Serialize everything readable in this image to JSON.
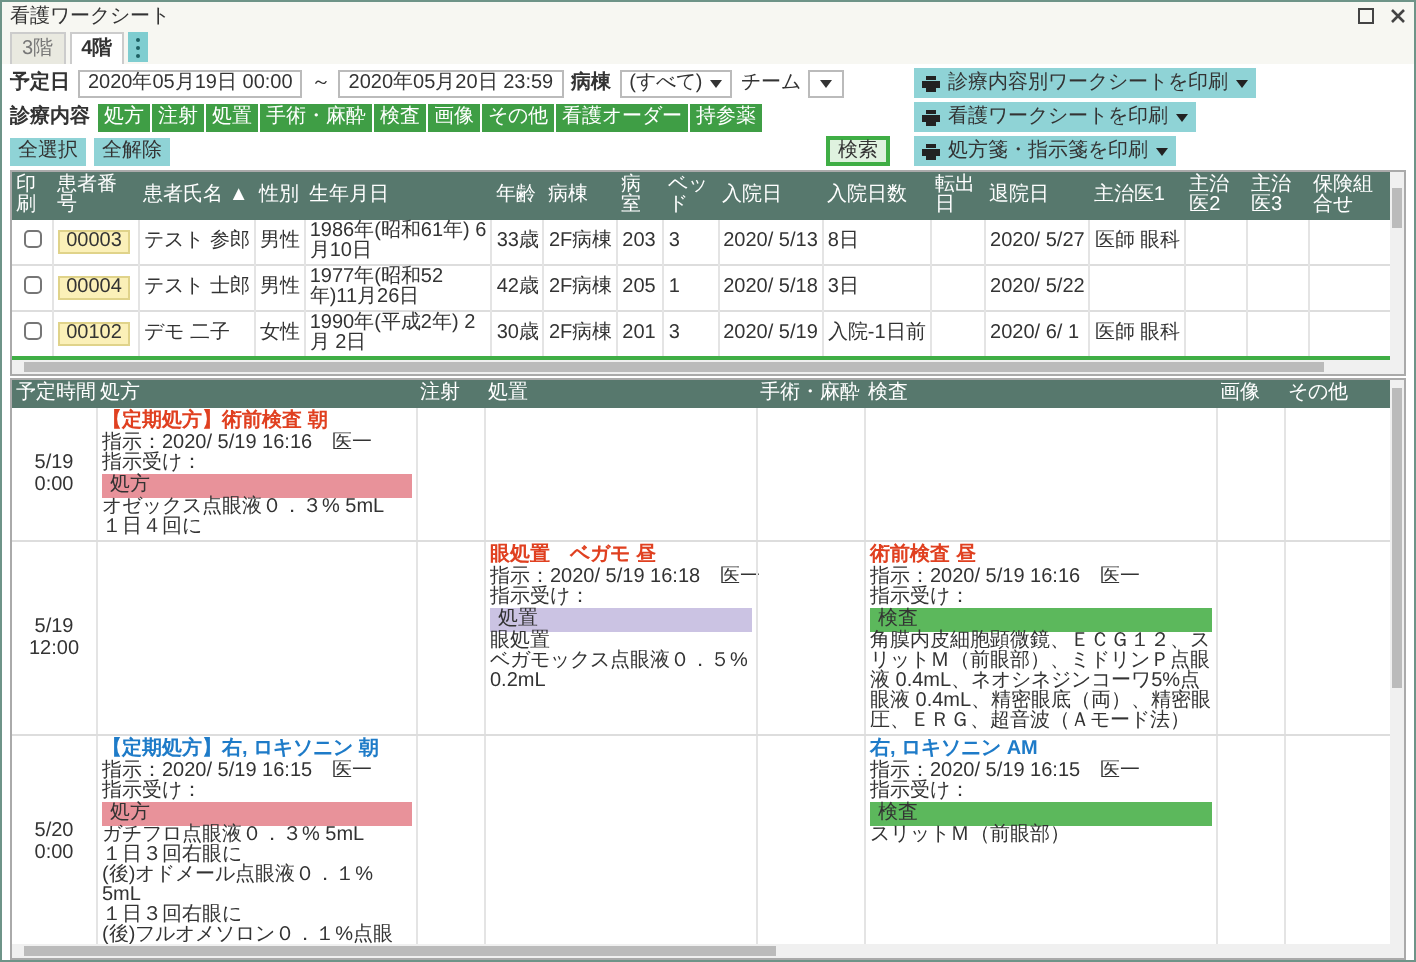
{
  "window": {
    "title": "看護ワークシート"
  },
  "tabs": [
    {
      "label": "3階",
      "selected": false
    },
    {
      "label": "4階",
      "selected": true
    }
  ],
  "filters": {
    "date_label": "予定日",
    "date_from": "2020年05月19日 00:00",
    "range_sep": "～",
    "date_to": "2020年05月20日 23:59",
    "ward_label": "病棟",
    "ward": "(すべて)",
    "team_label": "チーム",
    "category_label": "診療内容",
    "select_all": "全選択",
    "clear_all": "全解除",
    "search": "検索"
  },
  "categories": [
    {
      "label": "処方",
      "selected": true
    },
    {
      "label": "注射",
      "selected": true
    },
    {
      "label": "処置",
      "selected": true
    },
    {
      "label": "手術・麻酔",
      "selected": true
    },
    {
      "label": "検査",
      "selected": true
    },
    {
      "label": "画像",
      "selected": true
    },
    {
      "label": "その他",
      "selected": true
    },
    {
      "label": "看護オーダー",
      "selected": true
    },
    {
      "label": "持参薬",
      "selected": true
    }
  ],
  "print_buttons": [
    "診療内容別ワークシートを印刷",
    "看護ワークシートを印刷",
    "処方箋・指示箋を印刷"
  ],
  "patients": {
    "columns": [
      "印刷",
      "患者番号",
      "患者氏名 ▲",
      "性別",
      "生年月日",
      "年齢",
      "病棟",
      "病室",
      "ベッド",
      "入院日",
      "入院日数",
      "転出日",
      "退院日",
      "主治医1",
      "主治医2",
      "主治医3",
      "保険組合せ"
    ],
    "rows": [
      {
        "checked": false,
        "id": "00003",
        "name": "テスト 参郎",
        "sex": "男性",
        "birth": "1986年(昭和61年) 6月10日",
        "age": "33歳",
        "ward": "2F病棟",
        "room": "203",
        "bed": "3",
        "admitted": "2020/ 5/13",
        "days": "8日",
        "discharge": "2020/ 5/27",
        "doctor1": "医師 眼科"
      },
      {
        "checked": false,
        "id": "00004",
        "name": "テスト 士郎",
        "sex": "男性",
        "birth": "1977年(昭和52年)11月26日",
        "age": "42歳",
        "ward": "2F病棟",
        "room": "205",
        "bed": "1",
        "admitted": "2020/ 5/18",
        "days": "3日",
        "discharge": "2020/ 5/22"
      },
      {
        "checked": false,
        "id": "00102",
        "name": "デモ 二子",
        "sex": "女性",
        "birth": "1990年(平成2年) 2月 2日",
        "age": "30歳",
        "ward": "2F病棟",
        "room": "201",
        "bed": "3",
        "admitted": "2020/ 5/19",
        "days": "入院-1日前",
        "discharge": "2020/ 6/ 1",
        "doctor1": "医師 眼科"
      }
    ]
  },
  "worksheet": {
    "columns": [
      "予定時間",
      "処方",
      "注射",
      "処置",
      "手術・麻酔",
      "検査",
      "画像",
      "その他"
    ],
    "rows": [
      {
        "date": "5/19",
        "time": "0:00",
        "prescription": [
          {
            "title": "【定期処方】術前検査 朝",
            "color": "#e04020",
            "instruction": "指示：2020/ 5/19 16:16　医一",
            "acceptance": "指示受け：",
            "label": "処方",
            "lines": [
              "オゼックス点眼液０．３% 5mL",
              "１日４回に"
            ]
          }
        ]
      },
      {
        "date": "5/19",
        "time": "12:00",
        "treatment": [
          {
            "title": "眼処置　ベガモ 昼",
            "color": "#e04020",
            "instruction": "指示：2020/ 5/19 16:18　医一",
            "acceptance": "指示受け：",
            "label": "処置",
            "lines": [
              "眼処置",
              "ベガモックス点眼液０．５% 0.2mL"
            ]
          }
        ],
        "exam": [
          {
            "title": "術前検査 昼",
            "color": "#e04020",
            "instruction": "指示：2020/ 5/19 16:16　医一",
            "acceptance": "指示受け：",
            "label": "検査",
            "lines": [
              "角膜内皮細胞顕微鏡、ＥＣＧ１２、スリットＭ（前眼部）、ミドリンＰ点眼液 0.4mL、ネオシネジンコーワ5%点眼液 0.4mL、精密眼底（両）、精密眼圧、ＥＲＧ、超音波（Ａモード法）"
            ]
          }
        ]
      },
      {
        "date": "5/20",
        "time": "0:00",
        "prescription": [
          {
            "title": "【定期処方】右, ロキソニン 朝",
            "color": "#1e7bc8",
            "instruction": "指示：2020/ 5/19 16:15　医一",
            "acceptance": "指示受け：",
            "label": "処方",
            "lines": [
              "ガチフロ点眼液０．３% 5mL",
              "１日３回右眼に",
              "(後)オドメール点眼液０．１% 5mL",
              "１日３回右眼に",
              "(後)フルオメソロン０．１%点眼"
            ]
          }
        ],
        "exam": [
          {
            "title": "右, ロキソニン AM",
            "color": "#1e7bc8",
            "instruction": "指示：2020/ 5/19 16:15　医一",
            "acceptance": "指示受け：",
            "label": "検査",
            "lines": [
              "スリットＭ（前眼部）"
            ]
          }
        ]
      }
    ]
  }
}
